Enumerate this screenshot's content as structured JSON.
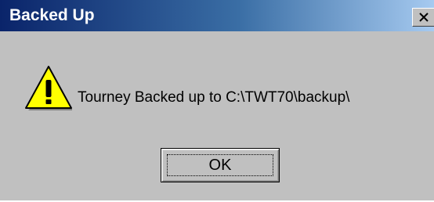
{
  "window": {
    "title": "Backed Up",
    "close_icon": "close-icon"
  },
  "message": {
    "icon": "warning-icon",
    "text": "Tourney Backed up to C:\\TWT70\\backup\\"
  },
  "buttons": {
    "ok_label": "OK"
  },
  "colors": {
    "titlebar_start": "#0a246a",
    "titlebar_end": "#a6caf0",
    "face": "#c0c0c0",
    "warning_fill": "#ffff00"
  }
}
